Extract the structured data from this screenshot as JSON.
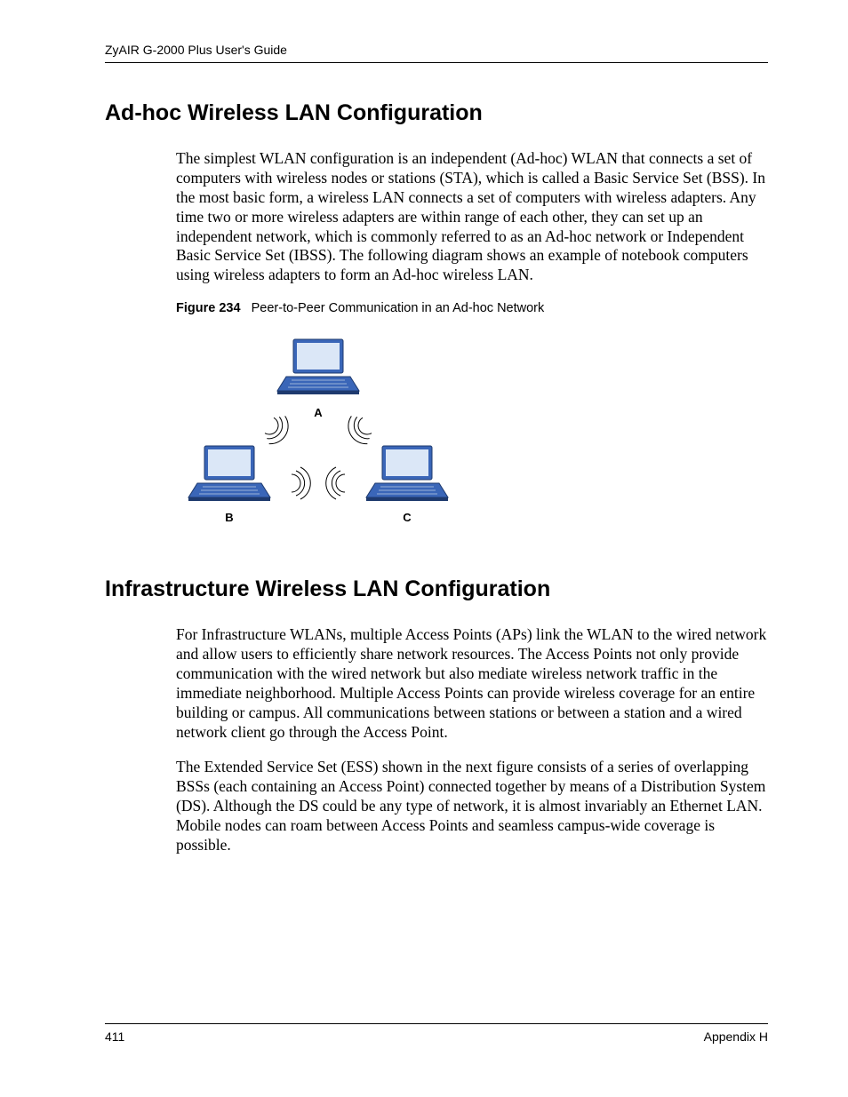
{
  "header": {
    "running_title": "ZyAIR G-2000 Plus User's Guide"
  },
  "sections": {
    "adhoc": {
      "heading": "Ad-hoc Wireless LAN Configuration",
      "para1": "The simplest WLAN configuration is an independent (Ad-hoc) WLAN that connects a set of computers with wireless nodes or stations (STA), which is called a Basic Service Set (BSS). In the most basic form, a wireless LAN connects a set of computers with wireless adapters. Any time two or more wireless adapters are within range of each other, they can set up an independent network, which is commonly referred to as an Ad-hoc network or Independent Basic Service Set (IBSS). The following diagram shows an example of notebook computers using wireless adapters to form an Ad-hoc wireless LAN."
    },
    "figure": {
      "label": "Figure 234",
      "caption": "Peer-to-Peer Communication in an Ad-hoc Network",
      "node_a": "A",
      "node_b": "B",
      "node_c": "C"
    },
    "infra": {
      "heading": "Infrastructure Wireless LAN Configuration",
      "para1": "For Infrastructure WLANs, multiple Access Points (APs) link the WLAN to the wired network and allow users to efficiently share network resources. The Access Points not only provide communication with the wired network but also mediate wireless network traffic in the immediate neighborhood. Multiple Access Points can provide wireless coverage for an entire building or campus. All communications between stations or between a station and a wired network client go through the Access Point.",
      "para2": "The Extended Service Set (ESS) shown in the next figure consists of a series of overlapping BSSs (each containing an Access Point) connected together by means of a Distribution System (DS). Although the DS could be any type of network, it is almost invariably an Ethernet LAN. Mobile nodes can roam between Access Points and seamless campus-wide coverage is possible."
    }
  },
  "footer": {
    "page_number": "411",
    "appendix": "Appendix H"
  }
}
